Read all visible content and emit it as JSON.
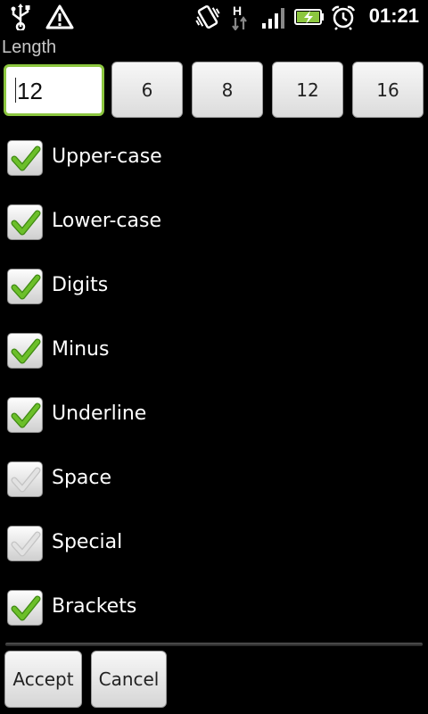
{
  "status_bar": {
    "time": "01:21",
    "icons": [
      "usb-icon",
      "warning-icon",
      "vibrate-icon",
      "hspa-data-icon",
      "signal-icon",
      "battery-charging-icon",
      "alarm-icon"
    ],
    "network_type": "H",
    "accent_color": "#8cc63f"
  },
  "length": {
    "label": "Length",
    "value": "12",
    "presets": [
      "6",
      "8",
      "12",
      "16"
    ]
  },
  "options": [
    {
      "label": "Upper-case",
      "checked": true
    },
    {
      "label": "Lower-case",
      "checked": true
    },
    {
      "label": "Digits",
      "checked": true
    },
    {
      "label": "Minus",
      "checked": true
    },
    {
      "label": "Underline",
      "checked": true
    },
    {
      "label": "Space",
      "checked": false
    },
    {
      "label": "Special",
      "checked": false
    },
    {
      "label": "Brackets",
      "checked": true
    }
  ],
  "actions": {
    "accept_label": "Accept",
    "cancel_label": "Cancel"
  }
}
